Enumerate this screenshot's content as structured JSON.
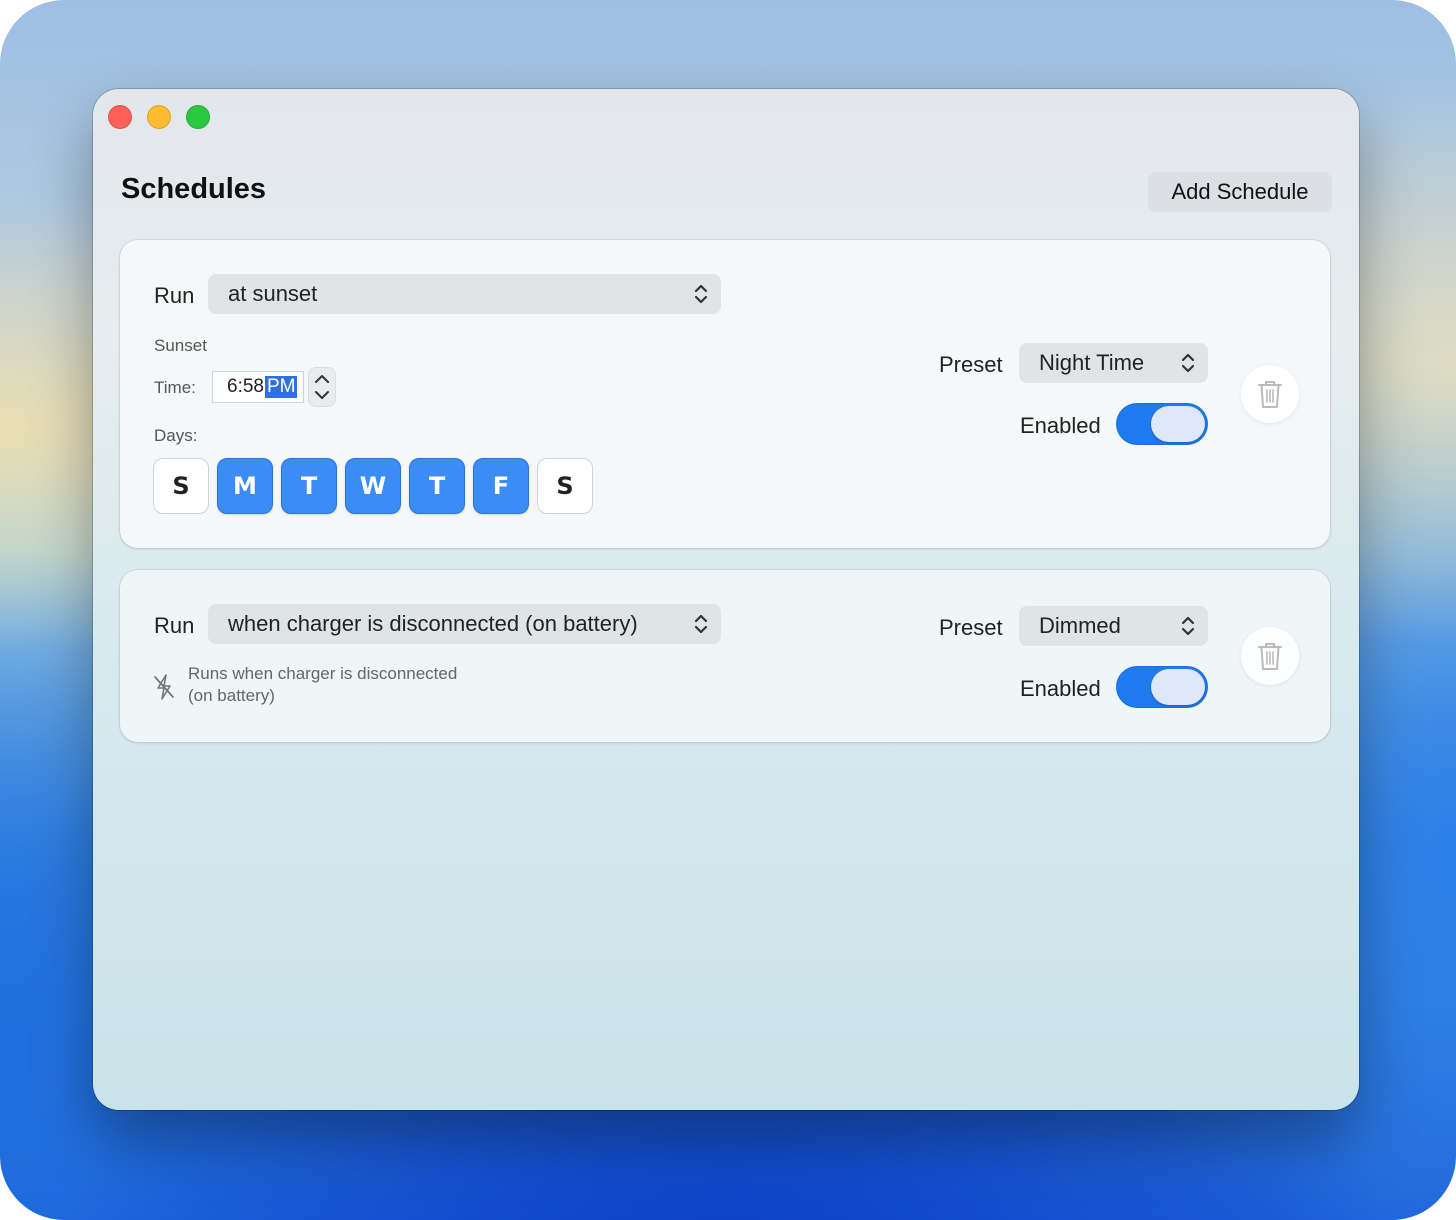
{
  "window": {
    "title": "Schedules",
    "add_button": "Add Schedule"
  },
  "schedules": [
    {
      "run_label": "Run",
      "run_value": "at sunset",
      "section_label": "Sunset",
      "time_label": "Time:",
      "time_value": "6:58",
      "time_ampm": "PM",
      "days_label": "Days:",
      "days": [
        {
          "letter": "S",
          "selected": false
        },
        {
          "letter": "M",
          "selected": true
        },
        {
          "letter": "T",
          "selected": true
        },
        {
          "letter": "W",
          "selected": true
        },
        {
          "letter": "T",
          "selected": true
        },
        {
          "letter": "F",
          "selected": true
        },
        {
          "letter": "S",
          "selected": false
        }
      ],
      "preset_label": "Preset",
      "preset_value": "Night Time",
      "enabled_label": "Enabled",
      "enabled": true
    },
    {
      "run_label": "Run",
      "run_value": "when charger is disconnected (on battery)",
      "note_line1": "Runs when charger is disconnected",
      "note_line2": "(on battery)",
      "preset_label": "Preset",
      "preset_value": "Dimmed",
      "enabled_label": "Enabled",
      "enabled": true
    }
  ],
  "icons": {
    "close": "close-window-icon",
    "minimize": "minimize-window-icon",
    "maximize": "maximize-window-icon",
    "popup_chevron": "chevron-up-down-icon",
    "stepper": "stepper-arrows-icon",
    "trash": "trash-icon",
    "no_power": "power-disconnected-icon"
  },
  "colors": {
    "accent": "#1f7af0",
    "day_selected": "#3b8cf5",
    "close": "#fe5f57",
    "minimize": "#febc2e",
    "maximize": "#28c840"
  }
}
